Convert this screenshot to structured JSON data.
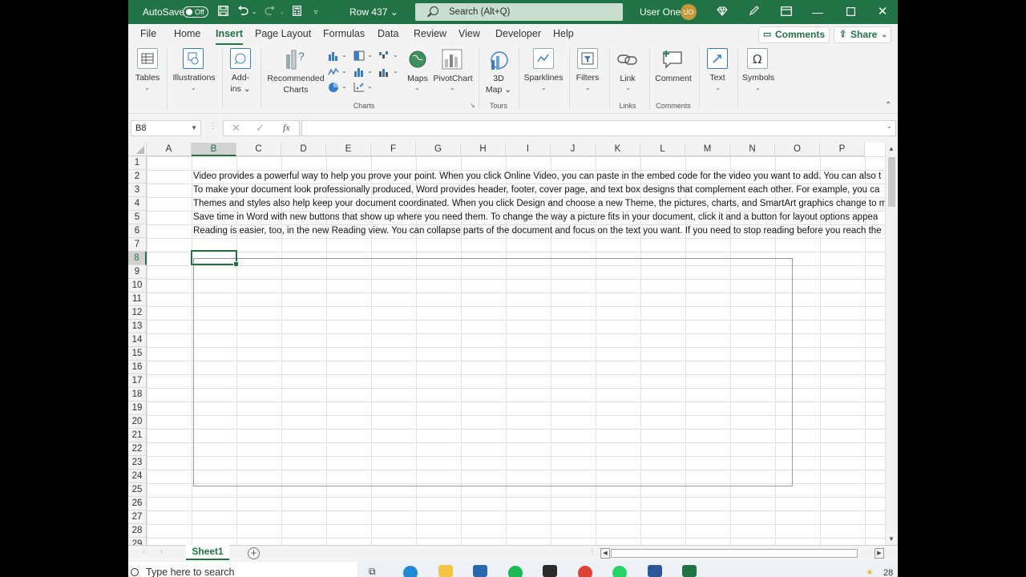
{
  "titlebar": {
    "autosave_label": "AutoSave",
    "autosave_state": "Off",
    "workbook_name": "Row 437",
    "search_placeholder": "Search (Alt+Q)",
    "user_name": "User One",
    "user_initials": "UO"
  },
  "menu": {
    "items": [
      "File",
      "Home",
      "Insert",
      "Page Layout",
      "Formulas",
      "Data",
      "Review",
      "View",
      "Developer",
      "Help"
    ],
    "active": "Insert",
    "comments_label": "Comments",
    "share_label": "Share"
  },
  "ribbon": {
    "tables": "Tables",
    "illustrations": "Illustrations",
    "addins_1": "Add-",
    "addins_2": "ins",
    "recommended_1": "Recommended",
    "recommended_2": "Charts",
    "maps": "Maps",
    "pivotchart": "PivotChart",
    "map3d_1": "3D",
    "map3d_2": "Map",
    "sparklines": "Sparklines",
    "filters": "Filters",
    "link": "Link",
    "comment": "Comment",
    "text": "Text",
    "symbols": "Symbols",
    "group_charts": "Charts",
    "group_tours": "Tours",
    "group_links": "Links",
    "group_comments": "Comments"
  },
  "formula_bar": {
    "name_box": "B8",
    "fx_label": "fx",
    "value": ""
  },
  "columns": [
    "A",
    "B",
    "C",
    "D",
    "E",
    "F",
    "G",
    "H",
    "I",
    "J",
    "K",
    "L",
    "M",
    "N",
    "O",
    "P"
  ],
  "rows": [
    "1",
    "2",
    "3",
    "4",
    "5",
    "6",
    "7",
    "8",
    "9",
    "10",
    "11",
    "12",
    "13",
    "14",
    "15",
    "16",
    "17",
    "18",
    "19",
    "20",
    "21",
    "22",
    "23",
    "24",
    "25",
    "26",
    "27",
    "28",
    "29"
  ],
  "cells": {
    "B2": "Video provides a powerful way to help you prove your point. When you click Online Video, you can paste in the embed code for the video you want to add. You can also t",
    "B3": "To make your document look professionally produced, Word provides header, footer, cover page, and text box designs that complement each other. For example, you ca",
    "B4": "Themes and styles also help keep your document coordinated. When you click Design and choose a new Theme, the pictures, charts, and SmartArt graphics change to mat",
    "B5": "Save time in Word with new buttons that show up where you need them. To change the way a picture fits in your document, click it and a button for layout options appea",
    "B6": "Reading is easier, too, in the new Reading view. You can collapse parts of the document and focus on the text you want. If you need to stop reading before you reach the"
  },
  "sheets": {
    "active": "Sheet1"
  },
  "taskbar": {
    "search_placeholder": "Type here to search",
    "temperature": "28"
  },
  "colors": {
    "excel_green": "#217346",
    "search_box": "#c8dfd0"
  }
}
